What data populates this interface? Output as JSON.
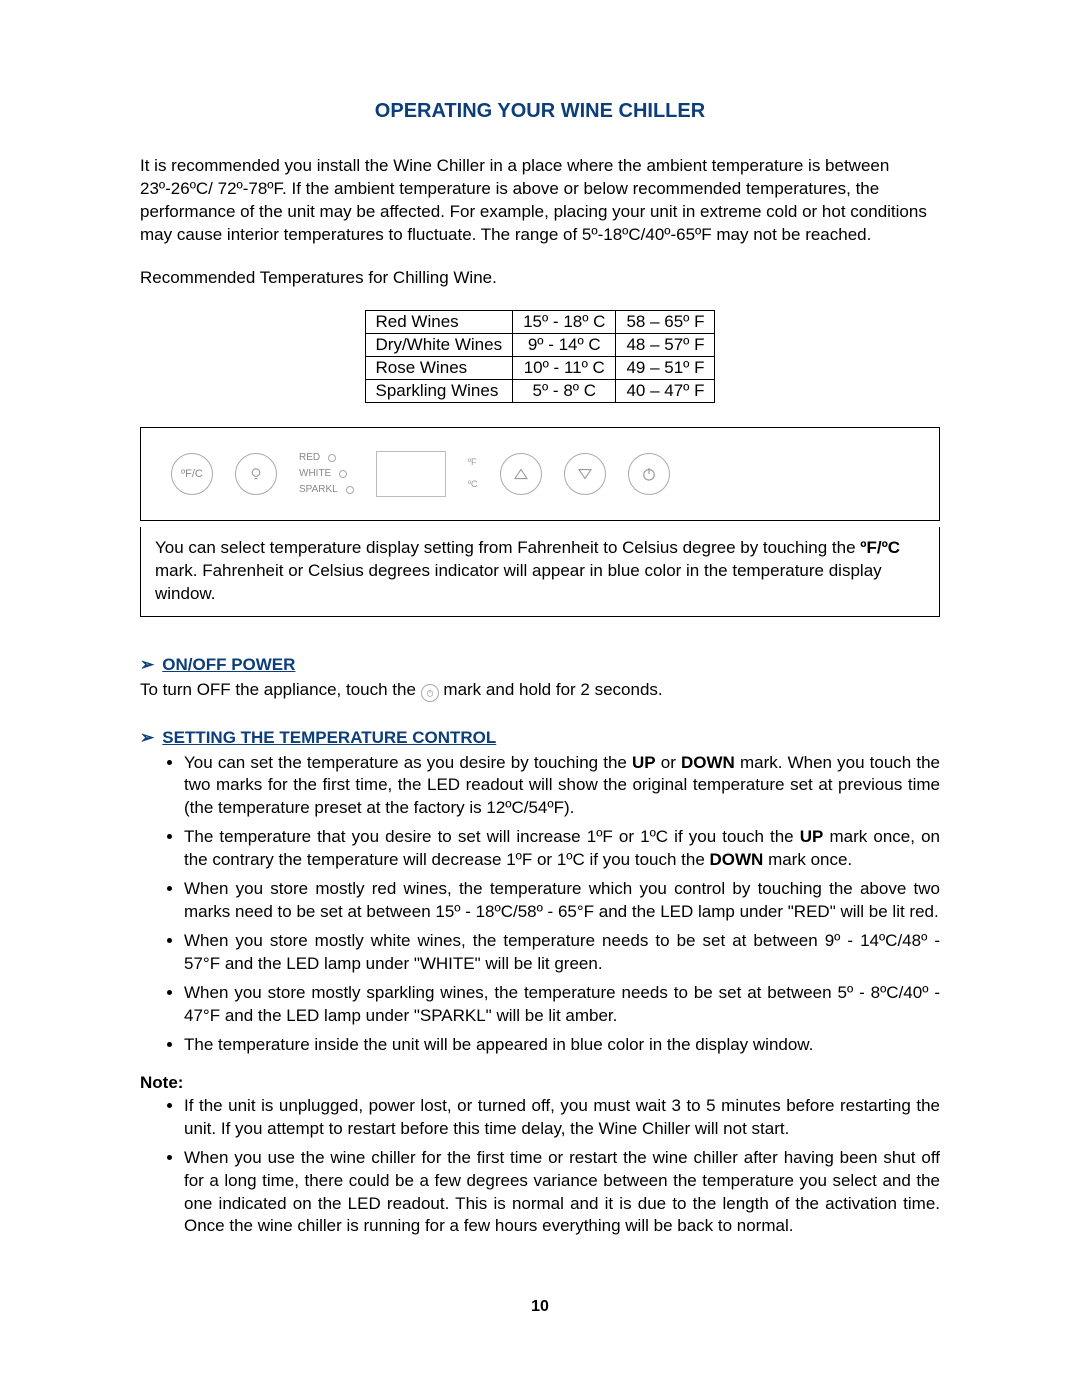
{
  "title": "OPERATING YOUR WINE CHILLER",
  "intro": "It is recommended you install the Wine Chiller in a place where the ambient temperature is between 23º-26ºC/ 72º-78ºF. If the ambient temperature is above or below recommended temperatures, the performance of the unit may be affected. For example, placing your unit in extreme cold or hot conditions may cause interior temperatures to fluctuate. The range of 5º-18ºC/40º-65ºF may not be reached.",
  "rec_line": "Recommended Temperatures for Chilling Wine.",
  "table": [
    {
      "name": "Red Wines",
      "c": "15º - 18º C",
      "f": "58 – 65º F"
    },
    {
      "name": "Dry/White Wines",
      "c": "9º - 14º  C",
      "f": "48 – 57º F"
    },
    {
      "name": "Rose Wines",
      "c": "10º - 11º C",
      "f": "49 – 51º F"
    },
    {
      "name": "Sparkling Wines",
      "c": "5º - 8º  C",
      "f": "40 – 47º F"
    }
  ],
  "panel": {
    "fc_label": "ºF/C",
    "leds": [
      "RED",
      "WHITE",
      "SPARKL"
    ],
    "deg_f": "ºF",
    "deg_c": "ºC"
  },
  "info_box_pre": "You can select temperature display setting from Fahrenheit to Celsius degree by touching the ",
  "info_box_bold": "ºF/ºC",
  "info_box_post": " mark. Fahrenheit or Celsius degrees indicator will appear in blue color in the temperature display window.",
  "sections": {
    "onoff": {
      "heading": "ON/OFF POWER",
      "text_pre": "To turn OFF the appliance, touch the",
      "text_post": "mark and hold  for 2 seconds."
    },
    "setting": {
      "heading": "SETTING THE TEMPERATURE CONTROL",
      "bullets": [
        {
          "pre": "You can set the temperature as you desire by touching the ",
          "b1": "UP",
          "mid": " or ",
          "b2": "DOWN",
          "post": " mark. When you touch the two marks for the first time, the LED readout will show the original temperature set at previous time (the temperature preset at the factory is 12ºC/54ºF)."
        },
        {
          "pre": "The temperature that you desire to set will increase 1ºF or 1ºC if you touch the ",
          "b1": "UP",
          "mid": " mark once, on the contrary the temperature will decrease 1ºF or 1ºC if you touch the ",
          "b2": "DOWN",
          "post": " mark once."
        },
        {
          "plain": "When you store mostly red wines, the temperature which you control by touching the above two marks need to be set at between 15º - 18ºC/58º - 65°F and the LED lamp under \"RED\" will be lit red."
        },
        {
          "plain": "When you store mostly white wines, the temperature needs to be set at between 9º - 14ºC/48º - 57°F and the LED lamp under \"WHITE\" will be lit green."
        },
        {
          "plain": "When you store mostly sparkling wines, the temperature needs to be set at between 5º - 8ºC/40º - 47°F and the LED lamp under \"SPARKL\" will be lit amber."
        },
        {
          "plain": "The temperature inside the unit will be appeared in blue color in the display window."
        }
      ]
    },
    "note": {
      "label": "Note:",
      "bullets": [
        "If the unit is unplugged, power lost, or turned off, you must wait 3 to 5 minutes before restarting the unit. If you attempt to restart before this time delay, the Wine Chiller will not start.",
        "When you use the wine chiller for the first time or restart the wine chiller after having been shut off for a long time, there could be a few degrees variance between the temperature you select and the one indicated on the LED readout.  This is normal and it is due to the length of the activation time. Once the wine chiller is running for a few hours everything will be back to normal."
      ]
    }
  },
  "page_number": "10"
}
